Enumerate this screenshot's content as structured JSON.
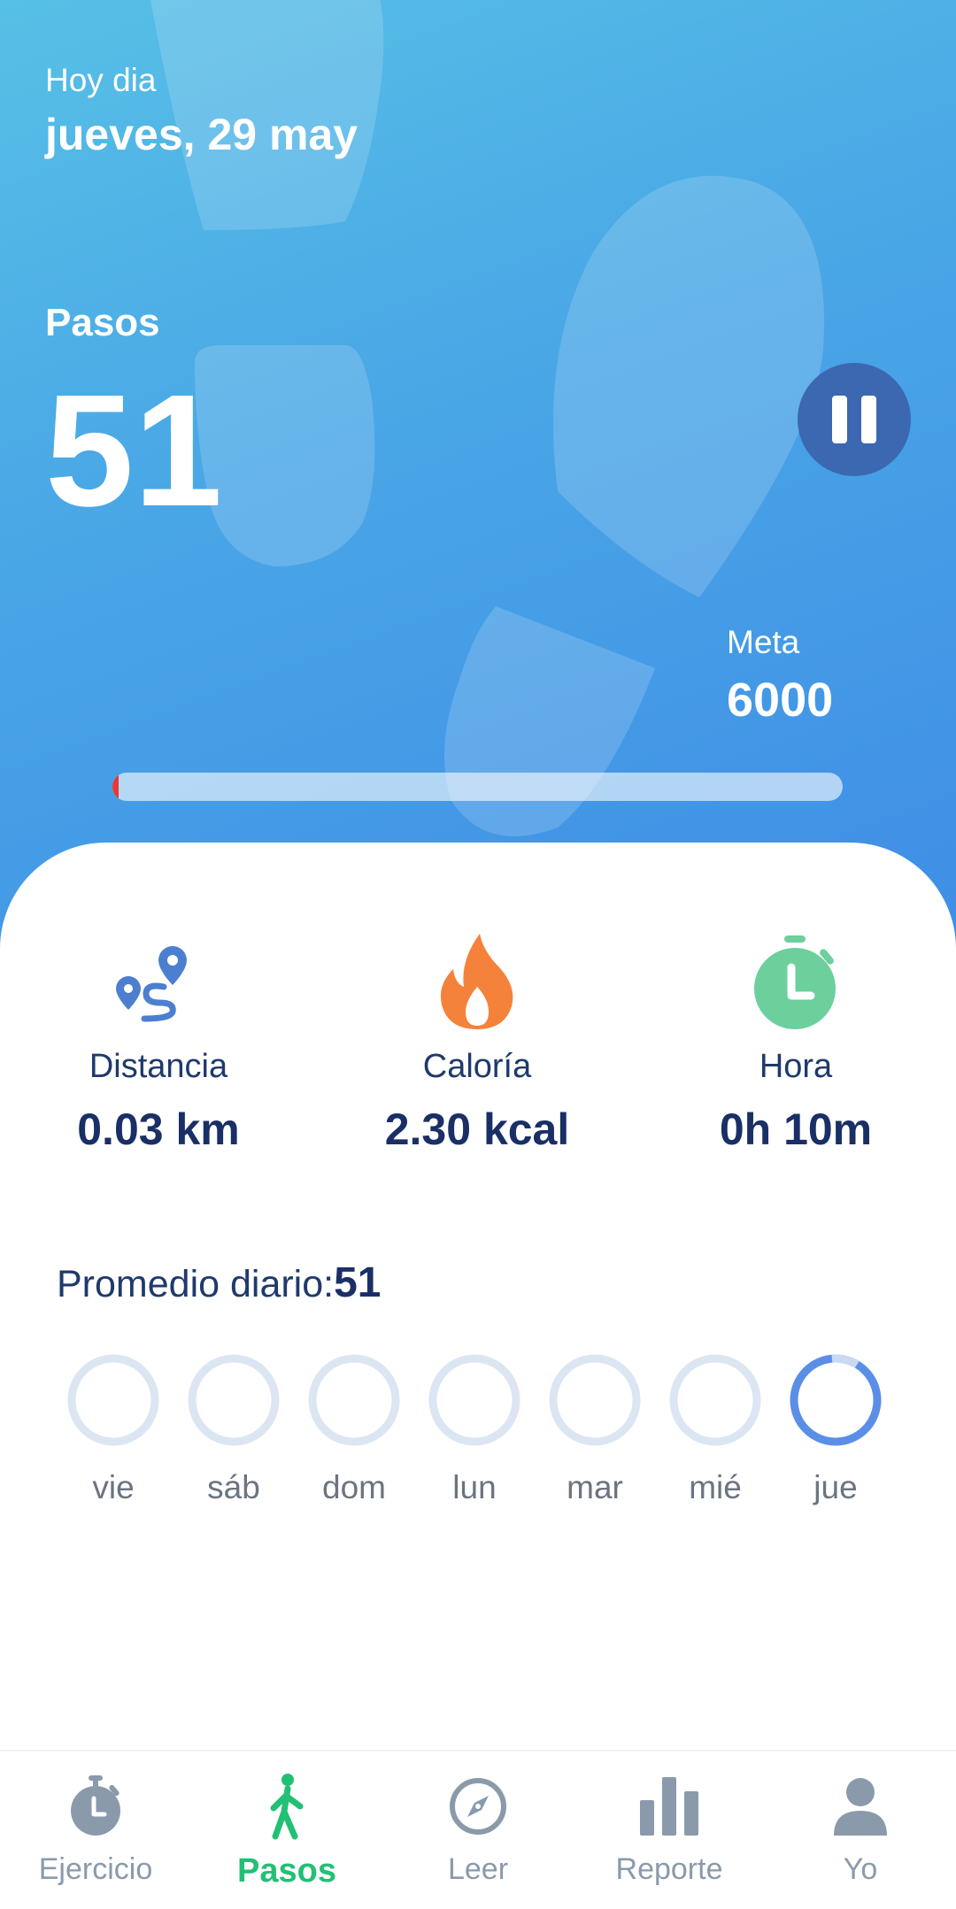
{
  "header": {
    "date_label": "Hoy dia",
    "date_value": "jueves, 29 may"
  },
  "steps": {
    "label": "Pasos",
    "value": "51",
    "goal_label": "Meta",
    "goal_value": "6000",
    "progress_fraction": 0.0085
  },
  "stats": {
    "distance": {
      "label": "Distancia",
      "value": "0.03 km",
      "icon": "route-pin-icon"
    },
    "calories": {
      "label": "Caloría",
      "value": "2.30 kcal",
      "icon": "flame-icon"
    },
    "time": {
      "label": "Hora",
      "value": "0h 10m",
      "icon": "stopwatch-icon"
    }
  },
  "daily_average": {
    "label": "Promedio diario:",
    "value": "51"
  },
  "week": [
    {
      "day": "vie",
      "progress": 0
    },
    {
      "day": "sáb",
      "progress": 0
    },
    {
      "day": "dom",
      "progress": 0
    },
    {
      "day": "lun",
      "progress": 0
    },
    {
      "day": "mar",
      "progress": 0
    },
    {
      "day": "mié",
      "progress": 0
    },
    {
      "day": "jue",
      "progress": 0.008
    }
  ],
  "nav": [
    {
      "label": "Ejercicio",
      "icon": "stopwatch-icon",
      "active": false
    },
    {
      "label": "Pasos",
      "icon": "walking-person-icon",
      "active": true
    },
    {
      "label": "Leer",
      "icon": "compass-icon",
      "active": false
    },
    {
      "label": "Reporte",
      "icon": "bar-chart-icon",
      "active": false
    },
    {
      "label": "Yo",
      "icon": "user-icon",
      "active": false
    }
  ],
  "colors": {
    "accent": "#22c074",
    "hero_start": "#57c0e6",
    "hero_end": "#3f8de6",
    "pause_button": "#3b68b0",
    "ring_empty": "#dce6f2",
    "ring_progress": "#5b8ee6",
    "distance_icon": "#4d7fd0",
    "calorie_icon": "#f5823a",
    "time_icon": "#6ccf9c"
  }
}
